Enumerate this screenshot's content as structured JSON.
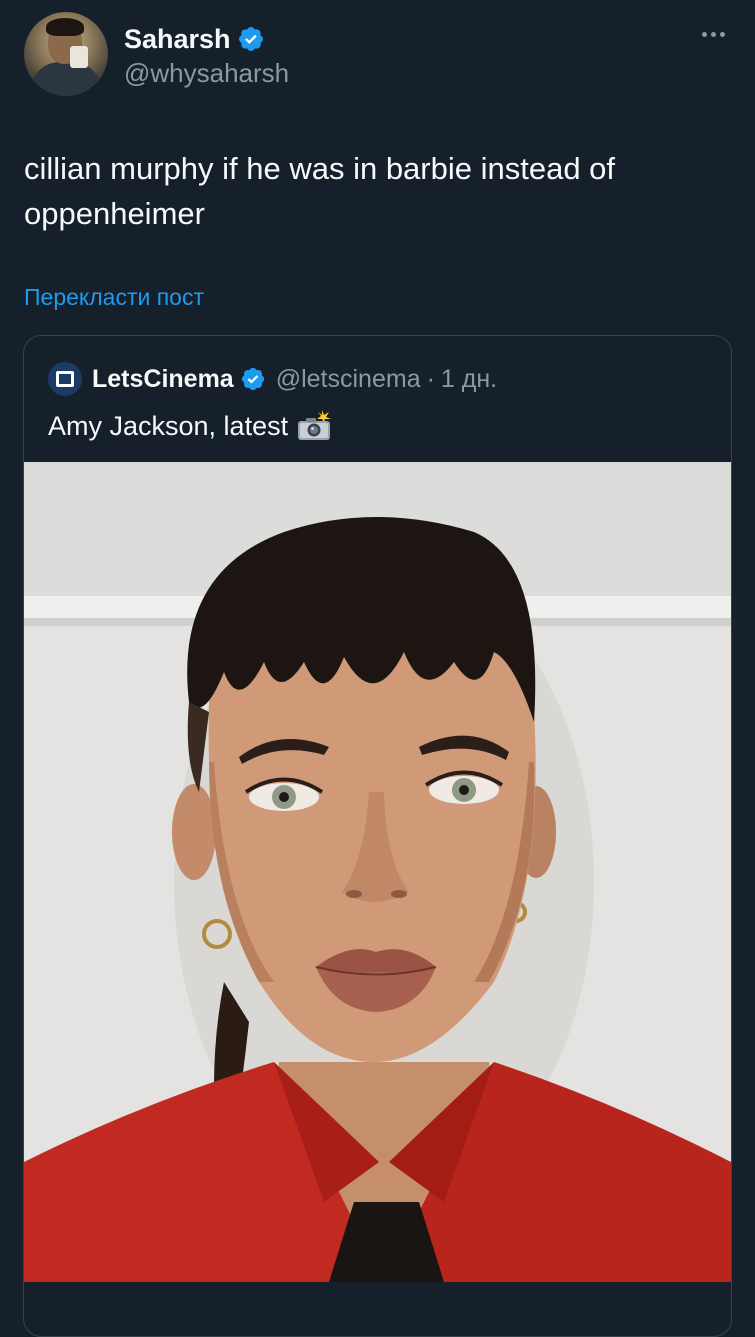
{
  "author": {
    "display_name": "Saharsh",
    "handle": "@whysaharsh",
    "avatar_icon": "profile-photo",
    "verified_icon": "verified-badge-icon"
  },
  "tweet": {
    "text": "cillian murphy if he was in barbie instead of oppenheimer",
    "translate_label": "Перекласти пост"
  },
  "quoted": {
    "display_name": "LetsCinema",
    "handle": "@letscinema",
    "separator": "·",
    "time": "1 дн.",
    "text": "Amy Jackson, latest",
    "emoji_icon": "camera-with-flash-icon",
    "image_icon": "portrait-photo"
  },
  "colors": {
    "background": "#15202b",
    "text": "#f7f9f9",
    "muted": "#8b98a5",
    "accent": "#1d9bf0",
    "border": "#38444d"
  }
}
